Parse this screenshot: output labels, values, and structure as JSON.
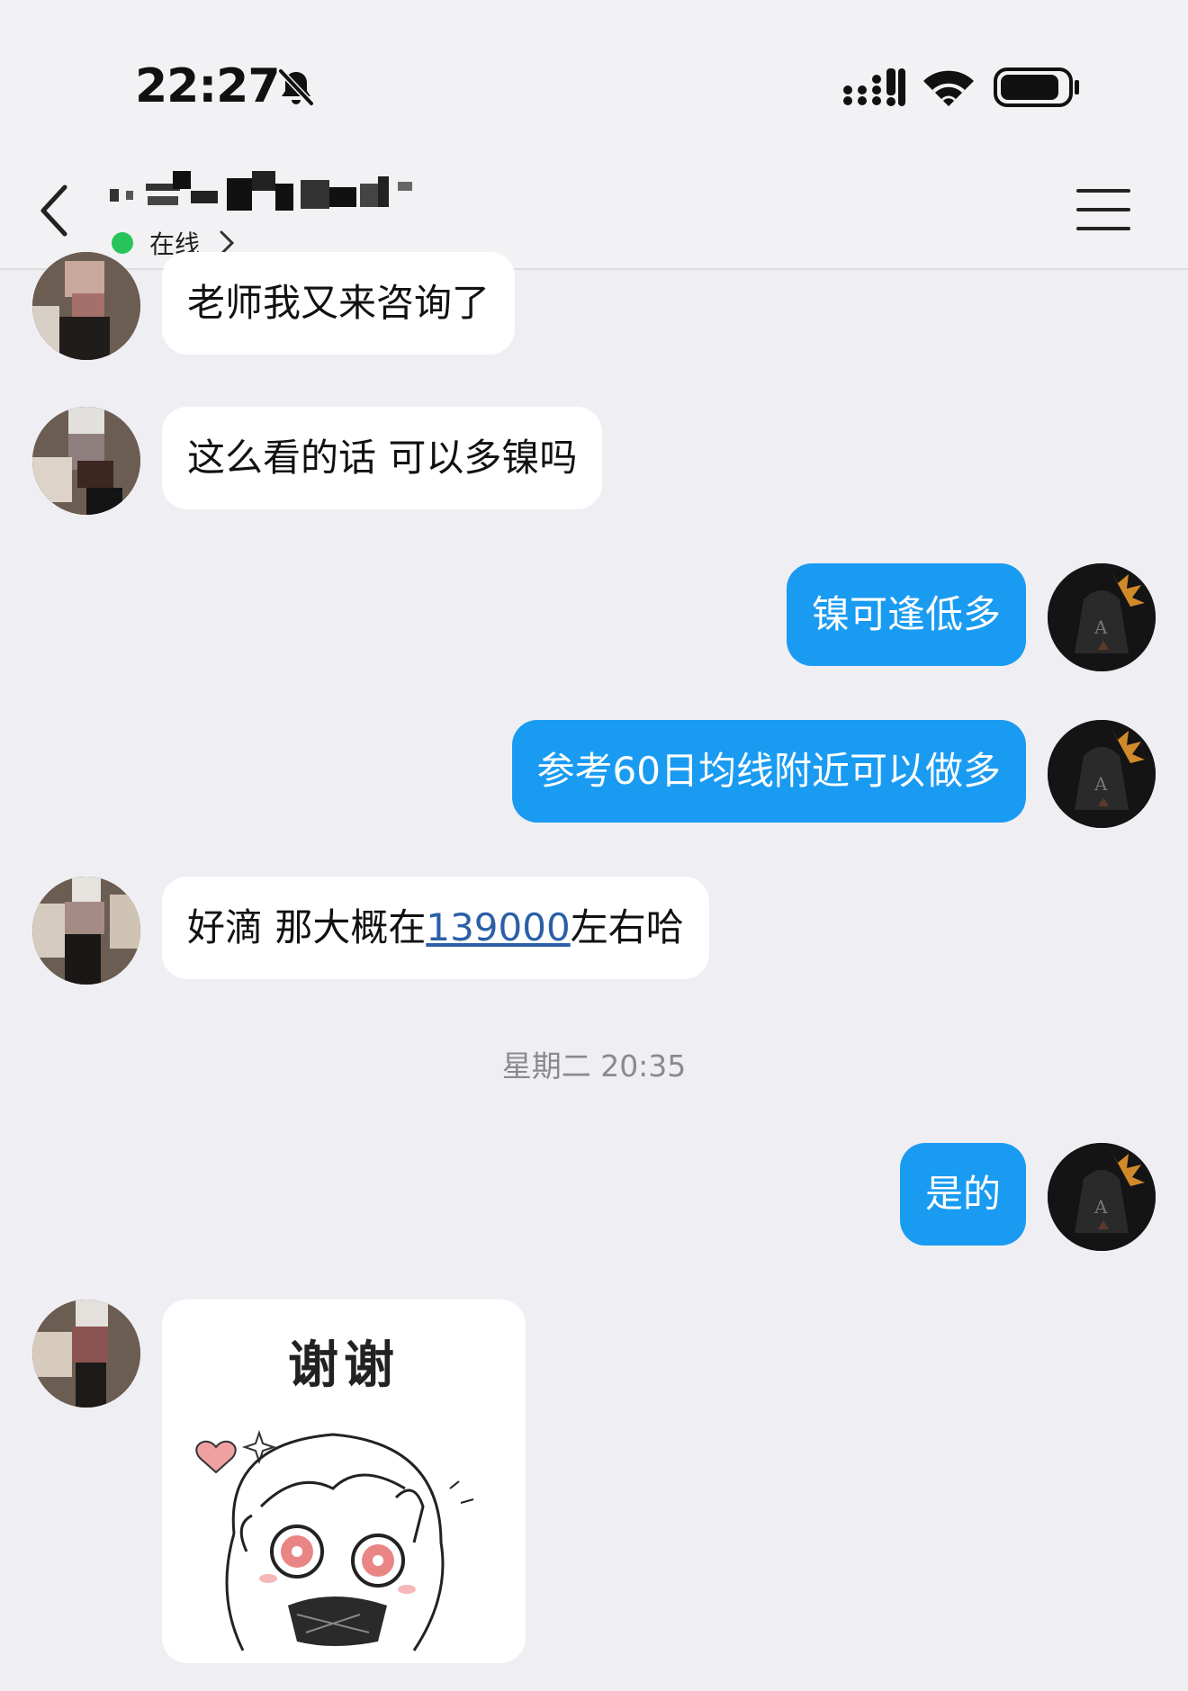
{
  "status_bar": {
    "time": "22:27",
    "icons": [
      "bell-muted-icon",
      "cellular-signal-icon",
      "wifi-icon",
      "battery-icon"
    ]
  },
  "header": {
    "status_text": "在线",
    "icons": [
      "back-chevron-icon",
      "chevron-right-icon",
      "hamburger-menu-icon"
    ]
  },
  "messages": [
    {
      "side": "in",
      "text": "老师我又来咨询了"
    },
    {
      "side": "in",
      "text": "这么看的话 可以多镍吗"
    },
    {
      "side": "out",
      "text": "镍可逢低多"
    },
    {
      "side": "out",
      "text": "参考60日均线附近可以做多"
    },
    {
      "side": "in",
      "text_before": "好滴 那大概在",
      "link_number": "139000",
      "text_after": "左右哈"
    },
    {
      "side": "out",
      "text": "是的"
    },
    {
      "side": "in",
      "type": "sticker",
      "sticker_text": "谢谢"
    }
  ],
  "timestamp": "星期二 20:35",
  "colors": {
    "background": "#efeff3",
    "outgoing_bubble": "#1a9bf2",
    "incoming_bubble": "#ffffff",
    "online_dot": "#27c45a",
    "link": "#2b5fa8"
  }
}
